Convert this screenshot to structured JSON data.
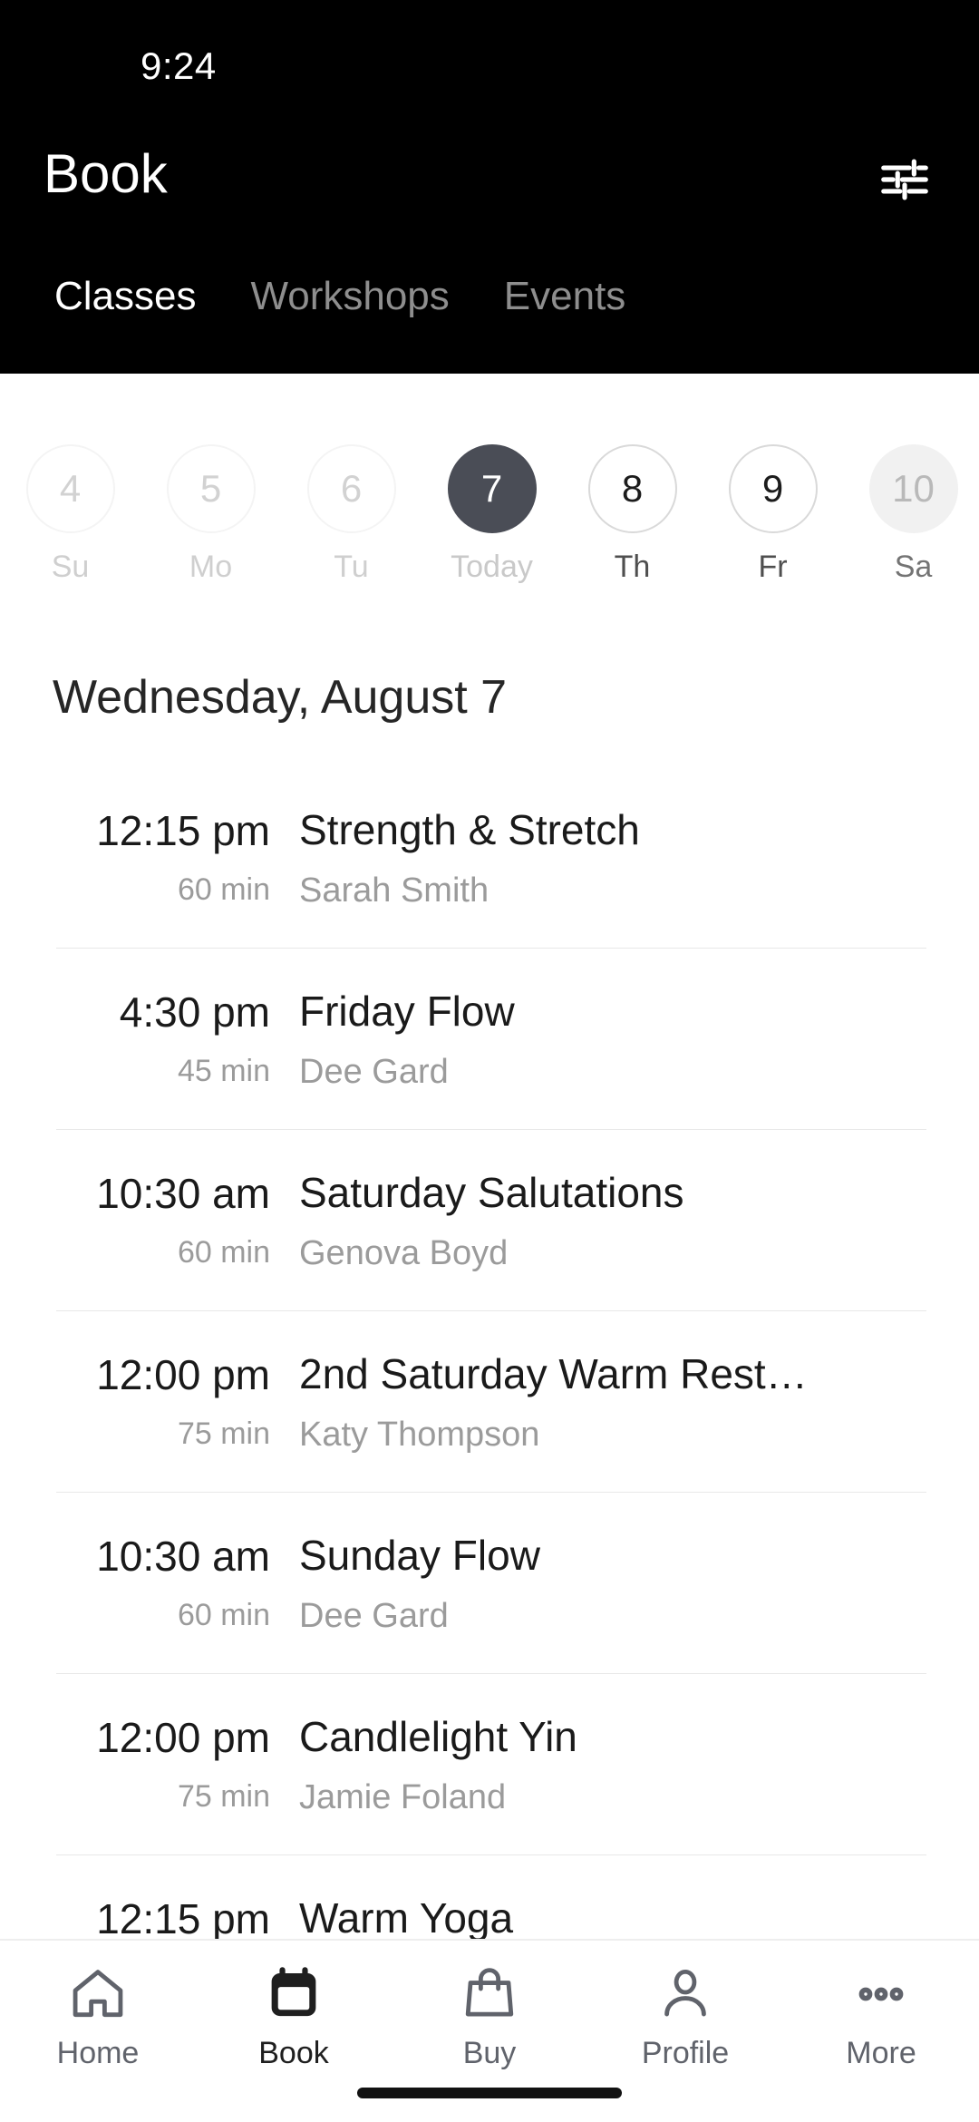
{
  "status_bar": {
    "time": "9:24"
  },
  "app_bar": {
    "title": "Book",
    "filter_icon": "sliders-filter-icon"
  },
  "tabs": [
    {
      "label": "Classes",
      "active": true
    },
    {
      "label": "Workshops",
      "active": false
    },
    {
      "label": "Events",
      "active": false
    }
  ],
  "date_strip": [
    {
      "day": "4",
      "weekday": "Su",
      "state": "past"
    },
    {
      "day": "5",
      "weekday": "Mo",
      "state": "past"
    },
    {
      "day": "6",
      "weekday": "Tu",
      "state": "past"
    },
    {
      "day": "7",
      "weekday": "Today",
      "state": "selected"
    },
    {
      "day": "8",
      "weekday": "Th",
      "state": "avail"
    },
    {
      "day": "9",
      "weekday": "Fr",
      "state": "avail"
    },
    {
      "day": "10",
      "weekday": "Sa",
      "state": "muted"
    }
  ],
  "date_heading": "Wednesday, August 7",
  "classes": [
    {
      "time": "12:15 pm",
      "duration": "60 min",
      "title": "Strength & Stretch",
      "teacher": "Sarah Smith"
    },
    {
      "time": "4:30 pm",
      "duration": "45 min",
      "title": "Friday Flow",
      "teacher": "Dee Gard"
    },
    {
      "time": "10:30 am",
      "duration": "60 min",
      "title": "Saturday Salutations",
      "teacher": "Genova Boyd"
    },
    {
      "time": "12:00 pm",
      "duration": "75 min",
      "title": "2nd Saturday Warm Rest…",
      "teacher": "Katy Thompson"
    },
    {
      "time": "10:30 am",
      "duration": "60 min",
      "title": "Sunday Flow",
      "teacher": "Dee Gard"
    },
    {
      "time": "12:00 pm",
      "duration": "75 min",
      "title": "Candlelight Yin",
      "teacher": "Jamie Foland"
    },
    {
      "time": "12:15 pm",
      "duration": "",
      "title": "Warm Yoga",
      "teacher": ""
    }
  ],
  "bottom_nav": [
    {
      "label": "Home",
      "icon": "house-icon",
      "active": false
    },
    {
      "label": "Book",
      "icon": "calendar-icon",
      "active": true
    },
    {
      "label": "Buy",
      "icon": "shopping-bag-icon",
      "active": false
    },
    {
      "label": "Profile",
      "icon": "person-icon",
      "active": false
    },
    {
      "label": "More",
      "icon": "ellipsis-icon",
      "active": false
    }
  ],
  "colors": {
    "header_bg": "#000000",
    "selected_day": "#4a4d56",
    "muted_day": "#f1f1f1",
    "divider": "#e8e8e8",
    "secondary_text": "#9b9b9b",
    "primary_text": "#1a1a1a",
    "nav_icon": "#60636b"
  }
}
